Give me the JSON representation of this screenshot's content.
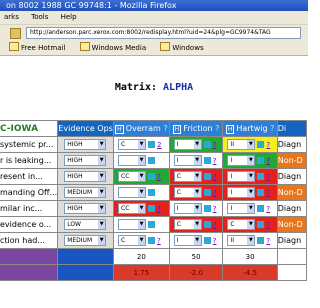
{
  "window": {
    "title": "on 8002 1988 GC 99748:1 - Mozilla Firefox"
  },
  "menu": [
    "arks",
    "Tools",
    "Help"
  ],
  "address": {
    "url": "http://anderson.parc.xerox.com:8002/redisplay.html?uid=24&plg=GC9974&TAG"
  },
  "bookmarks": [
    "Free Hotmail",
    "Windows Media",
    "Windows"
  ],
  "page": {
    "matrix_label": "Matrix:",
    "matrix_name": "ALPHA"
  },
  "header": {
    "name": "C-IOWA",
    "evidence": "Evidence Ops",
    "hide_label": "H",
    "help": "?",
    "cols": [
      "Overram",
      "Friction",
      "Hartwig"
    ],
    "last": "Di"
  },
  "rows": [
    {
      "name": "systemic pr...",
      "ev": "HIGH",
      "cells": [
        {
          "v": "C",
          "bg": "white",
          "q": "2"
        },
        {
          "v": "I",
          "bg": "green",
          "q": "?"
        },
        {
          "v": "II",
          "bg": "yellow",
          "q": "?"
        }
      ],
      "last": "Diagn",
      "lastStyle": "diag"
    },
    {
      "name": "r is leaking...",
      "ev": "HIGH",
      "cells": [
        {
          "v": "",
          "bg": "white",
          "q": ""
        },
        {
          "v": "I",
          "bg": "white",
          "q": "?"
        },
        {
          "v": "I",
          "bg": "green",
          "q": "?"
        }
      ],
      "last": "Non-D",
      "lastStyle": "nondel"
    },
    {
      "name": "resent in...",
      "ev": "HIGH",
      "cells": [
        {
          "v": "CC",
          "bg": "green",
          "q": "?"
        },
        {
          "v": "C",
          "bg": "red",
          "q": "?"
        },
        {
          "v": "I",
          "bg": "red",
          "q": "?"
        }
      ],
      "last": "Diagn",
      "lastStyle": "diag"
    },
    {
      "name": "manding Off...",
      "ev": "MEDIUM",
      "cells": [
        {
          "v": "",
          "bg": "white",
          "q": ""
        },
        {
          "v": "C",
          "bg": "red",
          "q": "?"
        },
        {
          "v": "I",
          "bg": "red",
          "q": "?"
        }
      ],
      "last": "Non-D",
      "lastStyle": "nondel"
    },
    {
      "name": "milar inc...",
      "ev": "HIGH",
      "cells": [
        {
          "v": "CC",
          "bg": "red",
          "q": "?"
        },
        {
          "v": "I",
          "bg": "white",
          "q": "?"
        },
        {
          "v": "I",
          "bg": "white",
          "q": "?"
        }
      ],
      "last": "Diagn",
      "lastStyle": "diag"
    },
    {
      "name": "evidence o...",
      "ev": "LOW",
      "cells": [
        {
          "v": "",
          "bg": "white",
          "q": ""
        },
        {
          "v": "C",
          "bg": "red",
          "q": "?"
        },
        {
          "v": "C",
          "bg": "red",
          "q": "?"
        }
      ],
      "last": "Non-D",
      "lastStyle": "nondel"
    },
    {
      "name": "ction had...",
      "ev": "MEDIUM",
      "cells": [
        {
          "v": "C",
          "bg": "white",
          "q": "?"
        },
        {
          "v": "I",
          "bg": "white",
          "q": "?"
        },
        {
          "v": "II",
          "bg": "white",
          "q": "?"
        }
      ],
      "last": "Diagn",
      "lastStyle": "diag"
    }
  ],
  "footer": {
    "weights": [
      "20",
      "50",
      "30"
    ],
    "scores": [
      "1.75",
      "-2.0",
      "-4.5"
    ]
  }
}
